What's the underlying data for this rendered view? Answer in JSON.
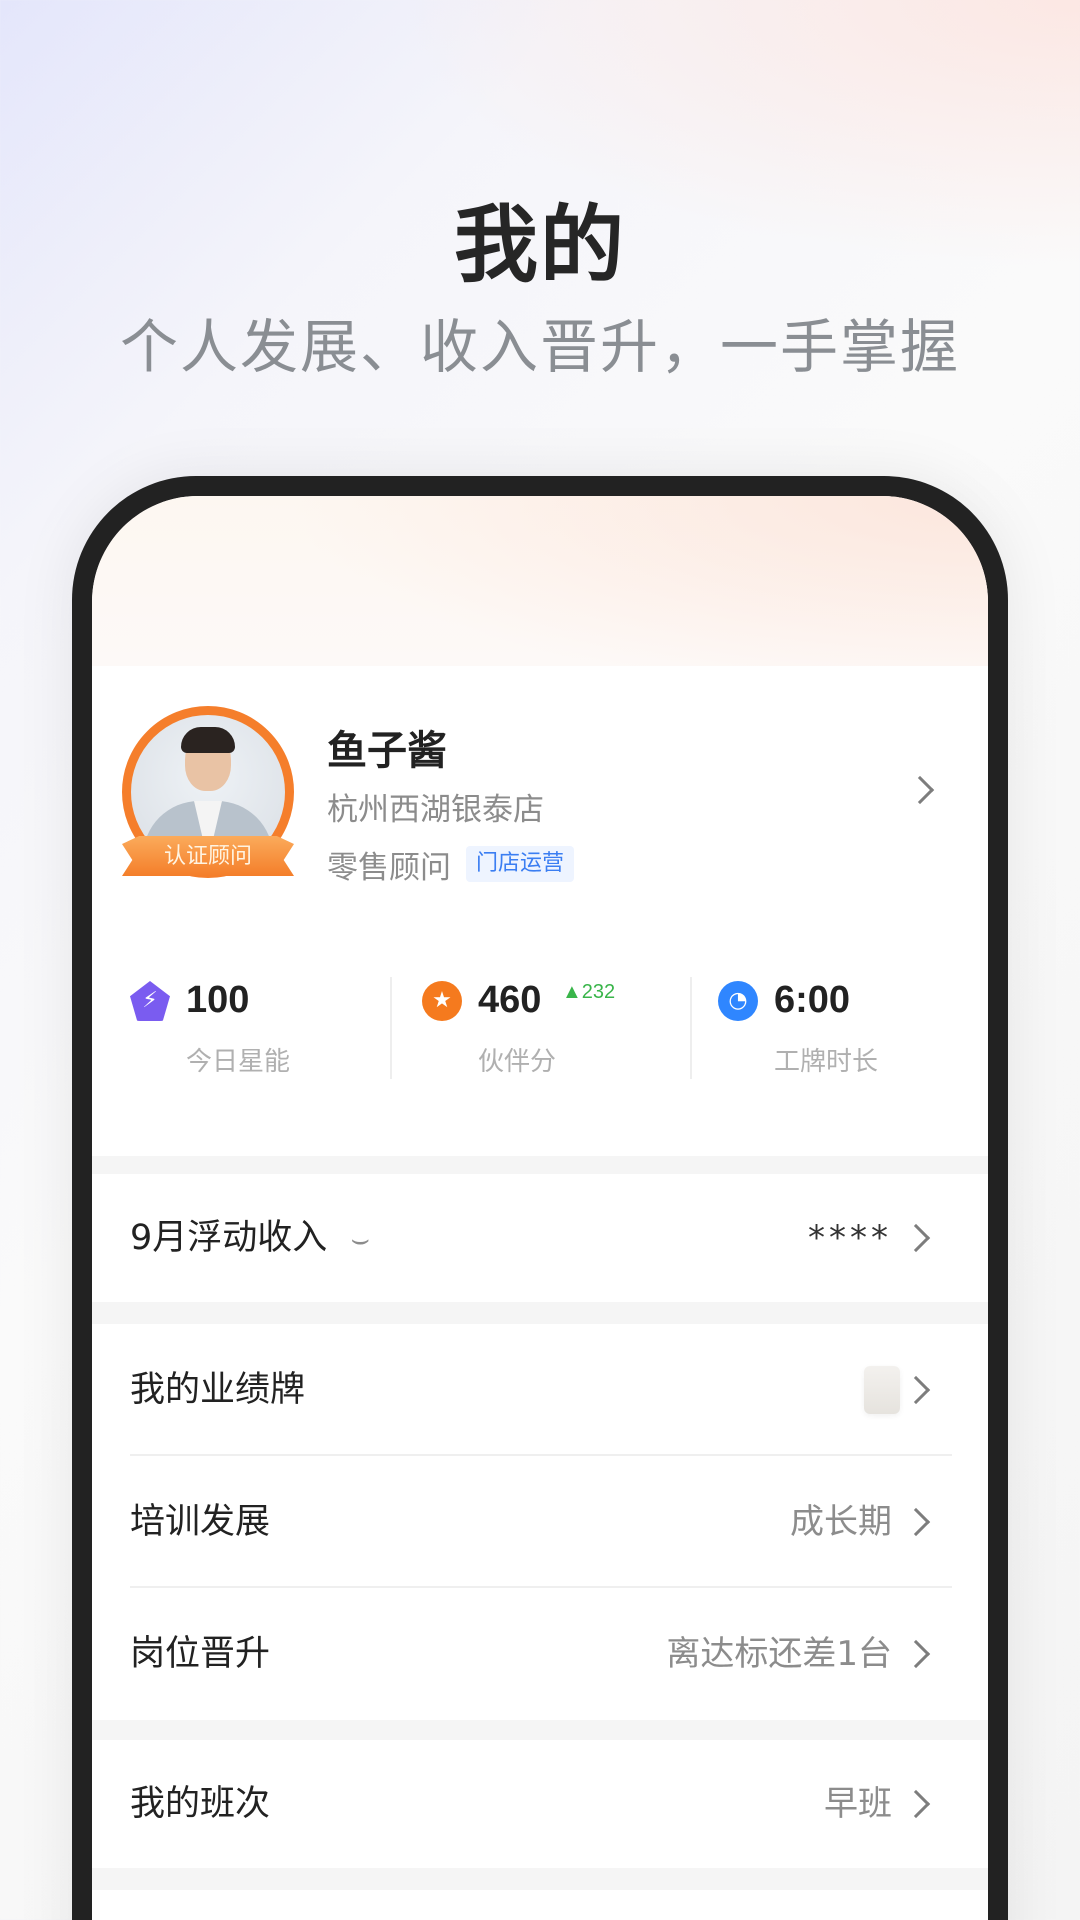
{
  "hero": {
    "title": "我的",
    "subtitle": "个人发展、收入晋升，一手掌握"
  },
  "profile": {
    "name": "鱼子酱",
    "store": "杭州西湖银泰店",
    "role": "零售顾问",
    "role_badge": "门店运营",
    "avatar_ribbon": "认证顾问"
  },
  "stats": [
    {
      "icon": "lightning-icon",
      "value": "100",
      "label": "今日星能",
      "color": "#7a5cf0"
    },
    {
      "icon": "star-badge-icon",
      "value": "460",
      "delta": "232",
      "label": "伙伴分",
      "color": "#f57a1e"
    },
    {
      "icon": "clock-icon",
      "value": "6:00",
      "label": "工牌时长",
      "color": "#2f86ff"
    }
  ],
  "income": {
    "label": "9月浮动收入",
    "value": "****"
  },
  "menu": {
    "performance": {
      "label": "我的业绩牌",
      "value": ""
    },
    "training": {
      "label": "培训发展",
      "value": "成长期"
    },
    "promotion": {
      "label": "岗位晋升",
      "value": "离达标还差1台"
    },
    "shift": {
      "label": "我的班次",
      "value": "早班"
    }
  },
  "colors": {
    "accent_orange": "#f57e2b",
    "badge_blue": "#3b7ef2",
    "delta_green": "#39b54a"
  }
}
